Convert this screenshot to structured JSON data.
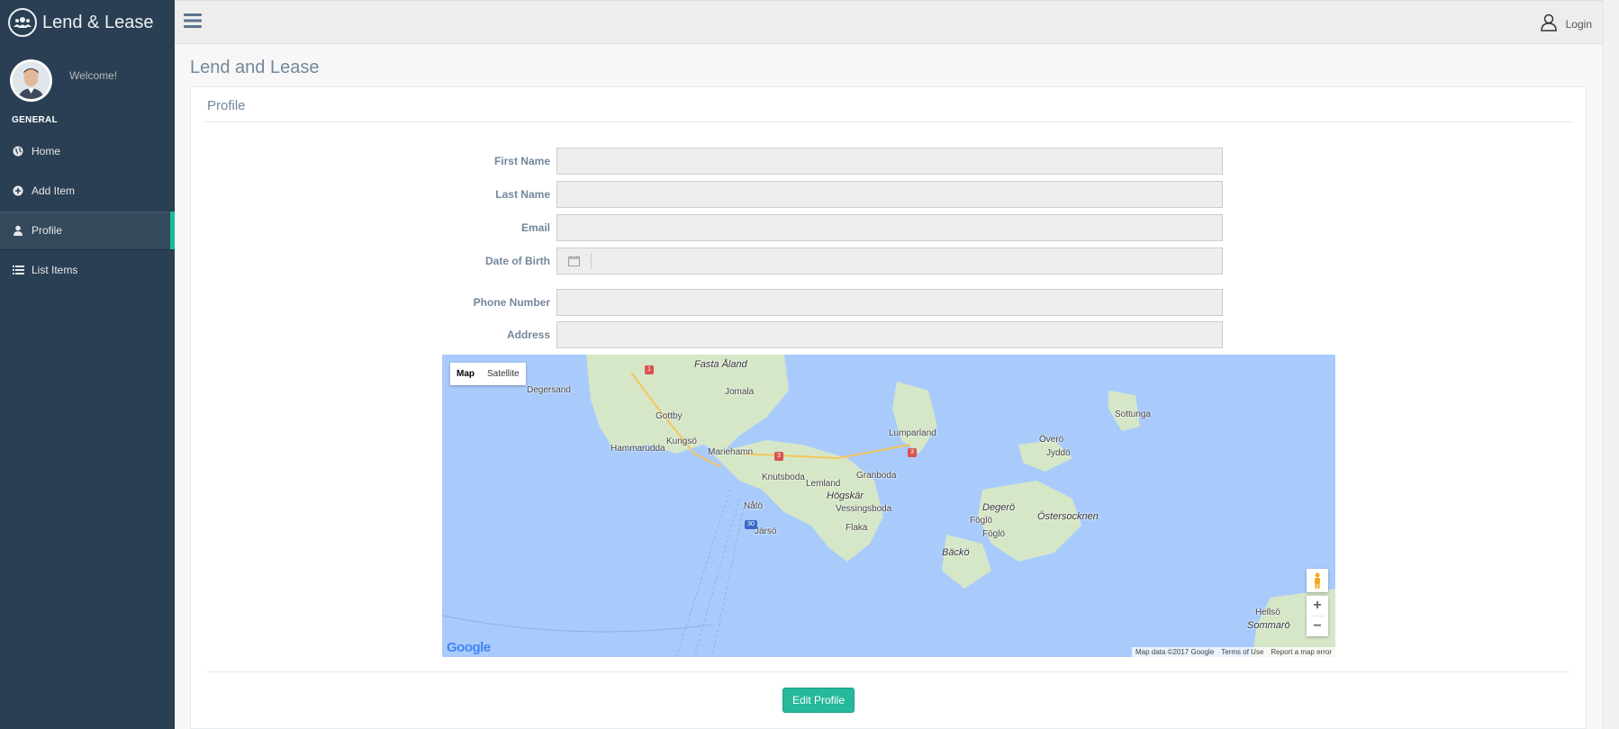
{
  "app": {
    "brand_title": "Lend & Lease",
    "accent": "#1abb9c",
    "sidebar_bg": "#2a3f54"
  },
  "sidebar": {
    "welcome": "Welcome!",
    "section_label": "GENERAL",
    "items": [
      {
        "label": "Home",
        "icon": "globe-icon",
        "active": false
      },
      {
        "label": "Add Item",
        "icon": "plus-circle-icon",
        "active": false
      },
      {
        "label": "Profile",
        "icon": "user-icon",
        "active": true
      },
      {
        "label": "List Items",
        "icon": "list-icon",
        "active": false
      }
    ]
  },
  "topbar": {
    "login_label": "Login"
  },
  "page": {
    "title": "Lend and Lease"
  },
  "panel": {
    "title": "Profile"
  },
  "form": {
    "first_name_label": "First Name",
    "last_name_label": "Last Name",
    "email_label": "Email",
    "dob_label": "Date of Birth",
    "phone_label": "Phone Number",
    "address_label": "Address",
    "first_name_value": "",
    "last_name_value": "",
    "email_value": "",
    "dob_value": "",
    "phone_value": "",
    "address_value": ""
  },
  "map": {
    "type_map": "Map",
    "type_satellite": "Satellite",
    "places": {
      "fasta_aland": "Fasta Åland",
      "degersand": "Degersand",
      "jomala": "Jomala",
      "gottby": "Gottby",
      "kungso": "Kungsö",
      "hammarudda": "Hammarudda",
      "mariehamn": "Mariehamn",
      "lumparland": "Lumparland",
      "knutsboda": "Knutsboda",
      "lemland": "Lemland",
      "granboda": "Granboda",
      "hogskar": "Högskär",
      "vessingsboda": "Vessingsboda",
      "nato": "Nåtö",
      "jarso": "Järsö",
      "flaka": "Flaka",
      "sottunga": "Sottunga",
      "overo": "Överö",
      "jyddo": "Jyddö",
      "degero": "Degerö",
      "ostersocknen": "Östersocknen",
      "foglo": "Föglö",
      "foglo2": "Föglö",
      "backo": "Bäckö",
      "hellso": "Hellsö",
      "sommaro": "Sommarö"
    },
    "road_badges": {
      "r1": "1",
      "r3a": "3",
      "r3b": "3",
      "r30": "30"
    },
    "google_logo": "Google",
    "attribution": {
      "data": "Map data ©2017 Google",
      "terms": "Terms of Use",
      "report": "Report a map error"
    }
  },
  "actions": {
    "edit_profile": "Edit Profile"
  }
}
